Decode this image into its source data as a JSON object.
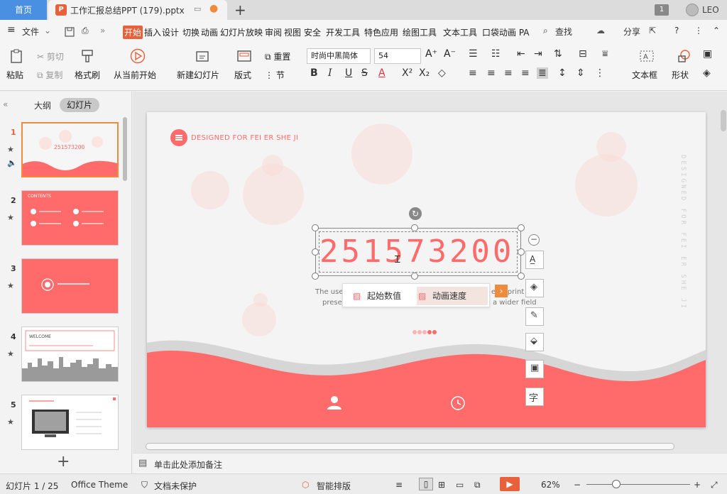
{
  "titlebar": {
    "home_tab": "首页",
    "doc_badge": "P",
    "doc_title": "工作汇报总结PPT (179).pptx",
    "new_tab": "+",
    "window_count": "1",
    "user_name": "LEO"
  },
  "menubar": {
    "file_label": "文件",
    "tabs": [
      "开始",
      "插入",
      "设计",
      "切换",
      "动画",
      "幻灯片放映",
      "审阅",
      "视图",
      "安全",
      "开发工具",
      "特色应用",
      "绘图工具",
      "文本工具",
      "口袋动画 PA"
    ],
    "active_tab": "开始",
    "search_label": "查找",
    "share_label": "分享"
  },
  "ribbon": {
    "paste_label": "粘贴",
    "cut_label": "剪切",
    "copy_label": "复制",
    "format_painter_label": "格式刷",
    "from_current_label": "从当前开始",
    "new_slide_label": "新建幻灯片",
    "layout_label": "版式",
    "reset_label": "重置",
    "section_label": "节",
    "font_name": "时尚中黑简体",
    "font_size": "54",
    "textbox_label": "文本框",
    "shape_label": "形状"
  },
  "left_panel": {
    "outline_tab": "大纲",
    "slides_tab": "幻灯片",
    "slides": [
      {
        "num": "1",
        "active": true
      },
      {
        "num": "2",
        "active": false
      },
      {
        "num": "3",
        "active": false
      },
      {
        "num": "4",
        "active": false
      },
      {
        "num": "5",
        "active": false
      }
    ],
    "thumb1_text": "251573200",
    "thumb2_text": "CONTENTS",
    "thumb4_text": "WELCOME"
  },
  "slide": {
    "brand": "DESIGNED FOR FEI ER SHE JI",
    "vertical_text": "DESIGNED FOR FEI ER SHE JI",
    "big_number": "251573200",
    "body_line1_left": "The use",
    "body_line1_right": "ent, print",
    "body_line2_left": "presen",
    "body_line2_right": "a wider field"
  },
  "float_menu": {
    "start_value": "起始数值",
    "anim_speed": "动画速度"
  },
  "notes": {
    "placeholder": "单击此处添加备注"
  },
  "statusbar": {
    "slide_info": "幻灯片 1 / 25",
    "theme": "Office Theme",
    "protection": "文档未保护",
    "smart_layout": "智能排版",
    "zoom": "62%"
  },
  "colors": {
    "accent": "#ff6b6b",
    "active_tab": "#e8613a",
    "home_tab": "#4a90e2"
  }
}
